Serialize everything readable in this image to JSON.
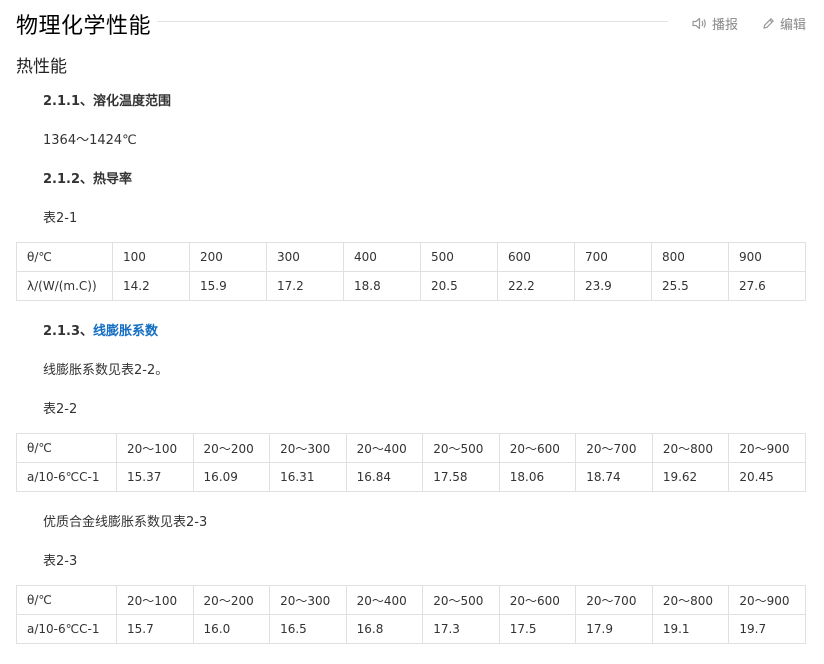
{
  "header": {
    "title": "物理化学性能",
    "play_label": "播报",
    "edit_label": "编辑",
    "play_icon": "speaker-icon",
    "edit_icon": "pencil-icon"
  },
  "section": {
    "title": "热性能"
  },
  "s211": {
    "heading": "2.1.1、溶化温度范围",
    "value": "1364～1424℃"
  },
  "s212": {
    "heading": "2.1.2、热导率",
    "caption": "表2-1"
  },
  "table1": {
    "rows": [
      [
        "θ/℃",
        "100",
        "200",
        "300",
        "400",
        "500",
        "600",
        "700",
        "800",
        "900"
      ],
      [
        "λ/(W/(m.C))",
        "14.2",
        "15.9",
        "17.2",
        "18.8",
        "20.5",
        "22.2",
        "23.9",
        "25.5",
        "27.6"
      ]
    ]
  },
  "s213": {
    "heading_prefix": "2.1.3、",
    "heading_link": "线膨胀系数",
    "text": "线膨胀系数见表2-2。",
    "caption": "表2-2"
  },
  "table2": {
    "rows": [
      [
        "θ/℃",
        "20～100",
        "20～200",
        "20～300",
        "20～400",
        "20～500",
        "20～600",
        "20～700",
        "20～800",
        "20～900"
      ],
      [
        "a/10-6℃C-1",
        "15.37",
        "16.09",
        "16.31",
        "16.84",
        "17.58",
        "18.06",
        "18.74",
        "19.62",
        "20.45"
      ]
    ]
  },
  "s214": {
    "text": "优质合金线膨胀系数见表2-3",
    "caption": "表2-3"
  },
  "table3": {
    "rows": [
      [
        "θ/℃",
        "20～100",
        "20～200",
        "20～300",
        "20～400",
        "20～500",
        "20～600",
        "20～700",
        "20～800",
        "20～900"
      ],
      [
        "a/10-6℃C-1",
        "15.7",
        "16.0",
        "16.5",
        "16.8",
        "17.3",
        "17.5",
        "17.9",
        "19.1",
        "19.7"
      ]
    ]
  }
}
